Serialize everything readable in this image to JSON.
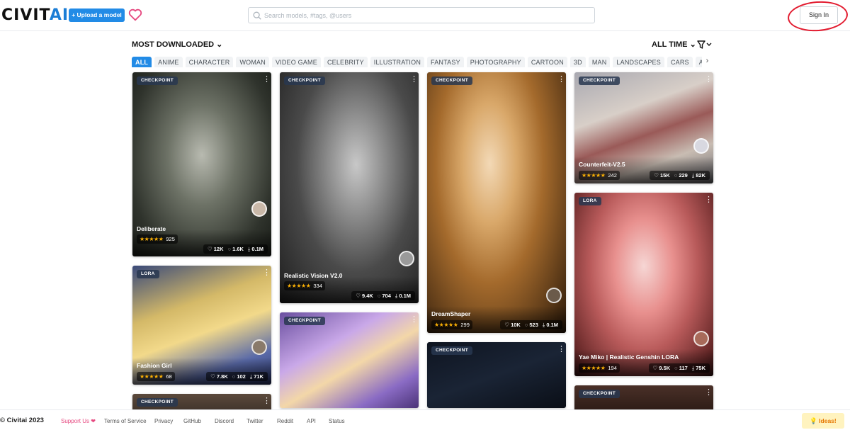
{
  "header": {
    "logo_part1": "CIVIT",
    "logo_part2": "AI",
    "upload_label": "+ Upload a model",
    "search_placeholder": "Search models, #tags, @users",
    "signin_label": "Sign In"
  },
  "toolbar": {
    "sort_label": "MOST DOWNLOADED ⌄",
    "period_label": "ALL TIME ⌄"
  },
  "tags": [
    "ALL",
    "ANIME",
    "CHARACTER",
    "WOMAN",
    "VIDEO GAME",
    "CELEBRITY",
    "ILLUSTRATION",
    "FANTASY",
    "PHOTOGRAPHY",
    "CARTOON",
    "3D",
    "MAN",
    "LANDSCAPES",
    "CARS",
    "ARCHITE"
  ],
  "cards": [
    {
      "type": "CHECKPOINT",
      "name": "Deliberate",
      "rating": "925",
      "likes": "12K",
      "comments": "1.6K",
      "downloads": "0.1M"
    },
    {
      "type": "LORA",
      "name": "Fashion Girl",
      "rating": "68",
      "likes": "7.8K",
      "comments": "102",
      "downloads": "71K"
    },
    {
      "type": "CHECKPOINT",
      "name": "",
      "rating": "",
      "likes": "",
      "comments": "",
      "downloads": ""
    },
    {
      "type": "CHECKPOINT",
      "name": "Realistic Vision V2.0",
      "rating": "334",
      "likes": "9.4K",
      "comments": "704",
      "downloads": "0.1M"
    },
    {
      "type": "CHECKPOINT",
      "name": "",
      "rating": "",
      "likes": "",
      "comments": "",
      "downloads": ""
    },
    {
      "type": "CHECKPOINT",
      "name": "DreamShaper",
      "rating": "299",
      "likes": "10K",
      "comments": "523",
      "downloads": "0.1M"
    },
    {
      "type": "CHECKPOINT",
      "name": "",
      "rating": "",
      "likes": "",
      "comments": "",
      "downloads": ""
    },
    {
      "type": "CHECKPOINT",
      "name": "Counterfeit-V2.5",
      "rating": "242",
      "likes": "15K",
      "comments": "229",
      "downloads": "82K"
    },
    {
      "type": "LORA",
      "name": "Yae Miko | Realistic Genshin LORA",
      "rating": "194",
      "likes": "9.5K",
      "comments": "117",
      "downloads": "75K"
    },
    {
      "type": "CHECKPOINT",
      "name": "",
      "rating": "",
      "likes": "",
      "comments": "",
      "downloads": ""
    }
  ],
  "stars": "★★★★★",
  "footer": {
    "copyright": "© Civitai 2023",
    "support": "Support Us ❤",
    "terms": "Terms of Service",
    "privacy": "Privacy",
    "github": "GitHub",
    "discord": "Discord",
    "twitter": "Twitter",
    "reddit": "Reddit",
    "api": "API",
    "status": "Status",
    "ideas": "💡 Ideas!"
  },
  "colors": {
    "accent": "#228be6",
    "star": "#fab005",
    "annotation": "#e21b2f"
  }
}
